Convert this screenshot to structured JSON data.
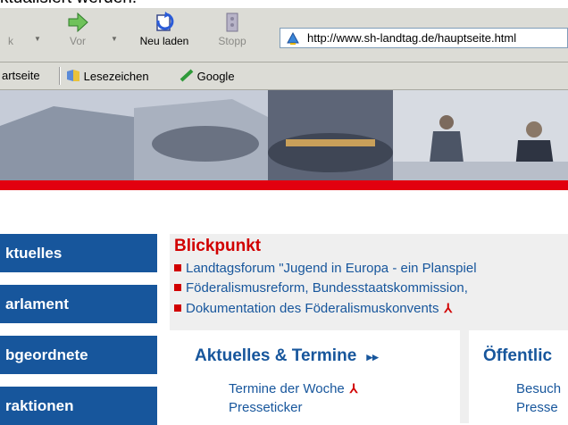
{
  "caption": "ktualisiert werden.",
  "toolbar": {
    "back_label": "k",
    "forward_label": "Vor",
    "reload_label": "Neu laden",
    "stop_label": "Stopp",
    "address": "http://www.sh-landtag.de/hauptseite.html"
  },
  "bookmarks": {
    "home_label": "artseite",
    "bookmarks_label": "Lesezeichen",
    "google_label": "Google"
  },
  "nav": [
    {
      "label": "ktuelles"
    },
    {
      "label": "arlament"
    },
    {
      "label": "bgeordnete"
    },
    {
      "label": "raktionen"
    }
  ],
  "blickpunkt": {
    "title": "Blickpunkt",
    "items": [
      {
        "text": "Landtagsforum \"Jugend in Europa - ein Planspiel"
      },
      {
        "text": "Föderalismusreform, Bundesstaatskommission,"
      },
      {
        "text": "Dokumentation des Föderalismuskonvents"
      }
    ]
  },
  "aktuelles": {
    "title": "Aktuelles & Termine",
    "more_icon": "double-chevron-right-icon",
    "links": [
      {
        "text": "Termine der Woche"
      },
      {
        "text": "Presseticker"
      }
    ]
  },
  "oeffentlich": {
    "title": "Öffentlic",
    "links": [
      {
        "text": "Besuch"
      },
      {
        "text": "Presse"
      }
    ]
  },
  "colors": {
    "nav_blue": "#17569c",
    "red": "#e2000f",
    "link_blue": "#17569c",
    "title_red": "#d10000"
  }
}
